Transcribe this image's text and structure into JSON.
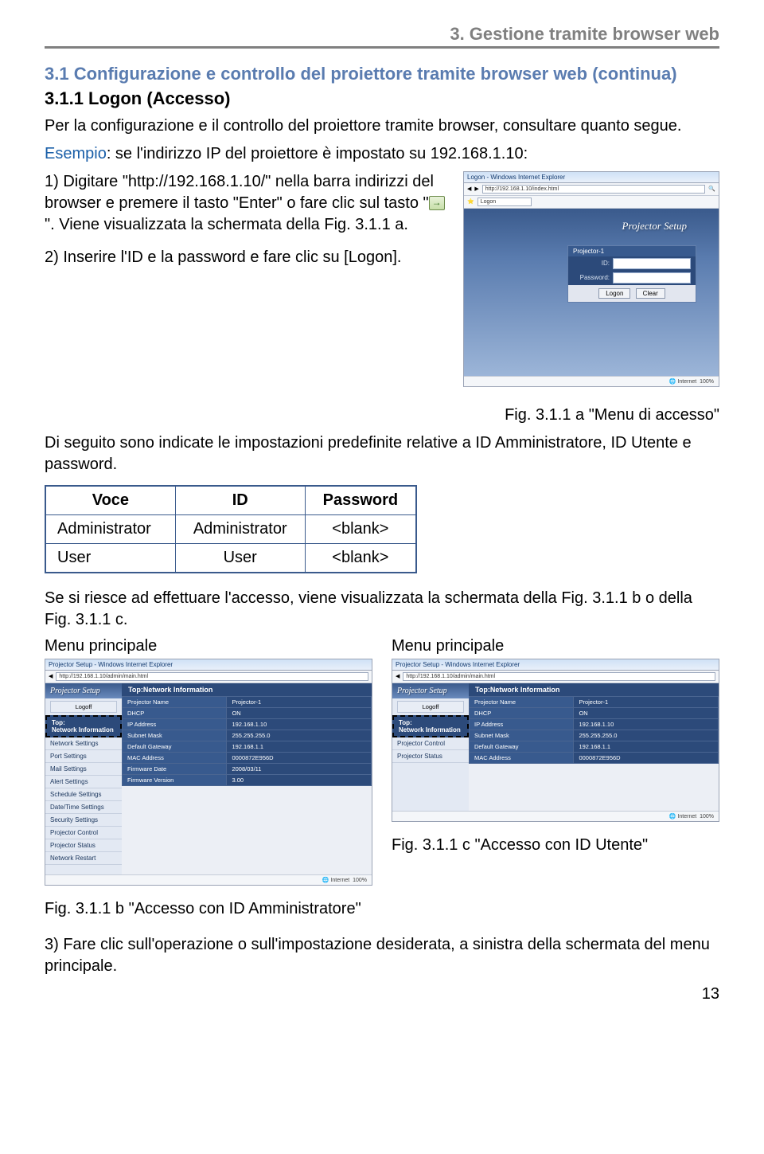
{
  "header": "3. Gestione tramite browser web",
  "blueTitle": "3.1 Configurazione e controllo del proiettore tramite browser web (continua)",
  "subTitle": "3.1.1 Logon (Accesso)",
  "intro": "Per la configurazione e il controllo del proiettore tramite browser, consultare quanto segue.",
  "esempioLabel": "Esempio",
  "esempioText": ": se l'indirizzo IP del proiettore è impostato su 192.168.1.10:",
  "step1a": "1) Digitare \"http://192.168.1.10/\" nella barra indirizzi del browser e premere il tasto \"Enter\" o fare clic sul tasto \"",
  "step1b": "\". Viene visualizzata la schermata della Fig. 3.1.1 a.",
  "step2": "2) Inserire l'ID e la password e fare clic su [Logon].",
  "figA": "Fig. 3.1.1 a \"Menu di accesso\"",
  "afterFigA": "Di seguito sono indicate le impostazioni predefinite relative a ID Amministratore, ID Utente e password.",
  "table": {
    "h1": "Voce",
    "h2": "ID",
    "h3": "Password",
    "rows": [
      {
        "c1": "Administrator",
        "c2": "Administrator",
        "c3": "<blank>"
      },
      {
        "c1": "User",
        "c2": "User",
        "c3": "<blank>"
      }
    ]
  },
  "afterTable": "Se si riesce ad effettuare l'accesso, viene visualizzata la schermata della Fig. 3.1.1 b o della Fig. 3.1.1 c.",
  "mpLabel": "Menu principale",
  "figB": "Fig. 3.1.1 b \"Accesso con ID Amministratore\"",
  "figC": "Fig. 3.1.1 c \"Accesso con ID Utente\"",
  "step3": "3) Fare clic sull'operazione o sull'impostazione desiderata, a sinistra della schermata del menu principale.",
  "pageNum": "13",
  "shot": {
    "browserTitle": "Logon - Windows Internet Explorer",
    "address": "http://192.168.1.10/index.html",
    "addrTab": "Logon",
    "psTitle": "Projector Setup",
    "proj1": "Projector-1",
    "idLbl": "ID:",
    "pwLbl": "Password:",
    "logon": "Logon",
    "clear": "Clear",
    "internet": "Internet",
    "zoom": "100%"
  },
  "admin": {
    "browserTitle": "Projector Setup - Windows Internet Explorer",
    "address": "http://192.168.1.10/admin/main.html",
    "logoff": "Logoff",
    "topH": "Top:Network Information",
    "side": {
      "top": "Top:",
      "net": "Network Information",
      "items": [
        "Network Settings",
        "Port Settings",
        "Mail Settings",
        "Alert Settings",
        "Schedule Settings",
        "Date/Time Settings",
        "Security Settings",
        "Projector Control",
        "Projector Status",
        "Network Restart"
      ],
      "itemsUser": [
        "Projector Control",
        "Projector Status"
      ]
    },
    "info": [
      [
        "Projector Name",
        "Projector-1"
      ],
      [
        "DHCP",
        "ON"
      ],
      [
        "IP Address",
        "192.168.1.10"
      ],
      [
        "Subnet Mask",
        "255.255.255.0"
      ],
      [
        "Default Gateway",
        "192.168.1.1"
      ],
      [
        "MAC Address",
        "0000872E956D"
      ],
      [
        "Firmware Date",
        "2008/03/11"
      ],
      [
        "Firmware Version",
        "3.00"
      ]
    ],
    "infoUser": [
      [
        "Projector Name",
        "Projector-1"
      ],
      [
        "DHCP",
        "ON"
      ],
      [
        "IP Address",
        "192.168.1.10"
      ],
      [
        "Subnet Mask",
        "255.255.255.0"
      ],
      [
        "Default Gateway",
        "192.168.1.1"
      ],
      [
        "MAC Address",
        "0000872E956D"
      ]
    ]
  }
}
